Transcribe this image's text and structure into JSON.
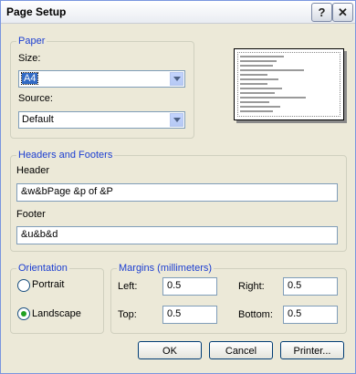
{
  "window": {
    "title": "Page Setup"
  },
  "titlebar_buttons": {
    "help": "?",
    "close": "✕"
  },
  "paper": {
    "legend": "Paper",
    "size_label": "Size:",
    "size_value": "A4",
    "source_label": "Source:",
    "source_value": "Default"
  },
  "headers_footers": {
    "legend": "Headers and Footers",
    "header_label": "Header",
    "header_value": "&w&bPage &p of &P",
    "footer_label": "Footer",
    "footer_value": "&u&b&d"
  },
  "orientation": {
    "legend": "Orientation",
    "portrait_label": "Portrait",
    "landscape_label": "Landscape",
    "selected": "Landscape"
  },
  "margins": {
    "legend": "Margins (millimeters)",
    "left_label": "Left:",
    "left_value": "0.5",
    "right_label": "Right:",
    "right_value": "0.5",
    "top_label": "Top:",
    "top_value": "0.5",
    "bottom_label": "Bottom:",
    "bottom_value": "0.5"
  },
  "buttons": {
    "ok": "OK",
    "cancel": "Cancel",
    "printer": "Printer..."
  },
  "colors": {
    "accent": "#1c3ed1",
    "radio_selected": "#21a121",
    "dialog_bg": "#ece9d8"
  }
}
